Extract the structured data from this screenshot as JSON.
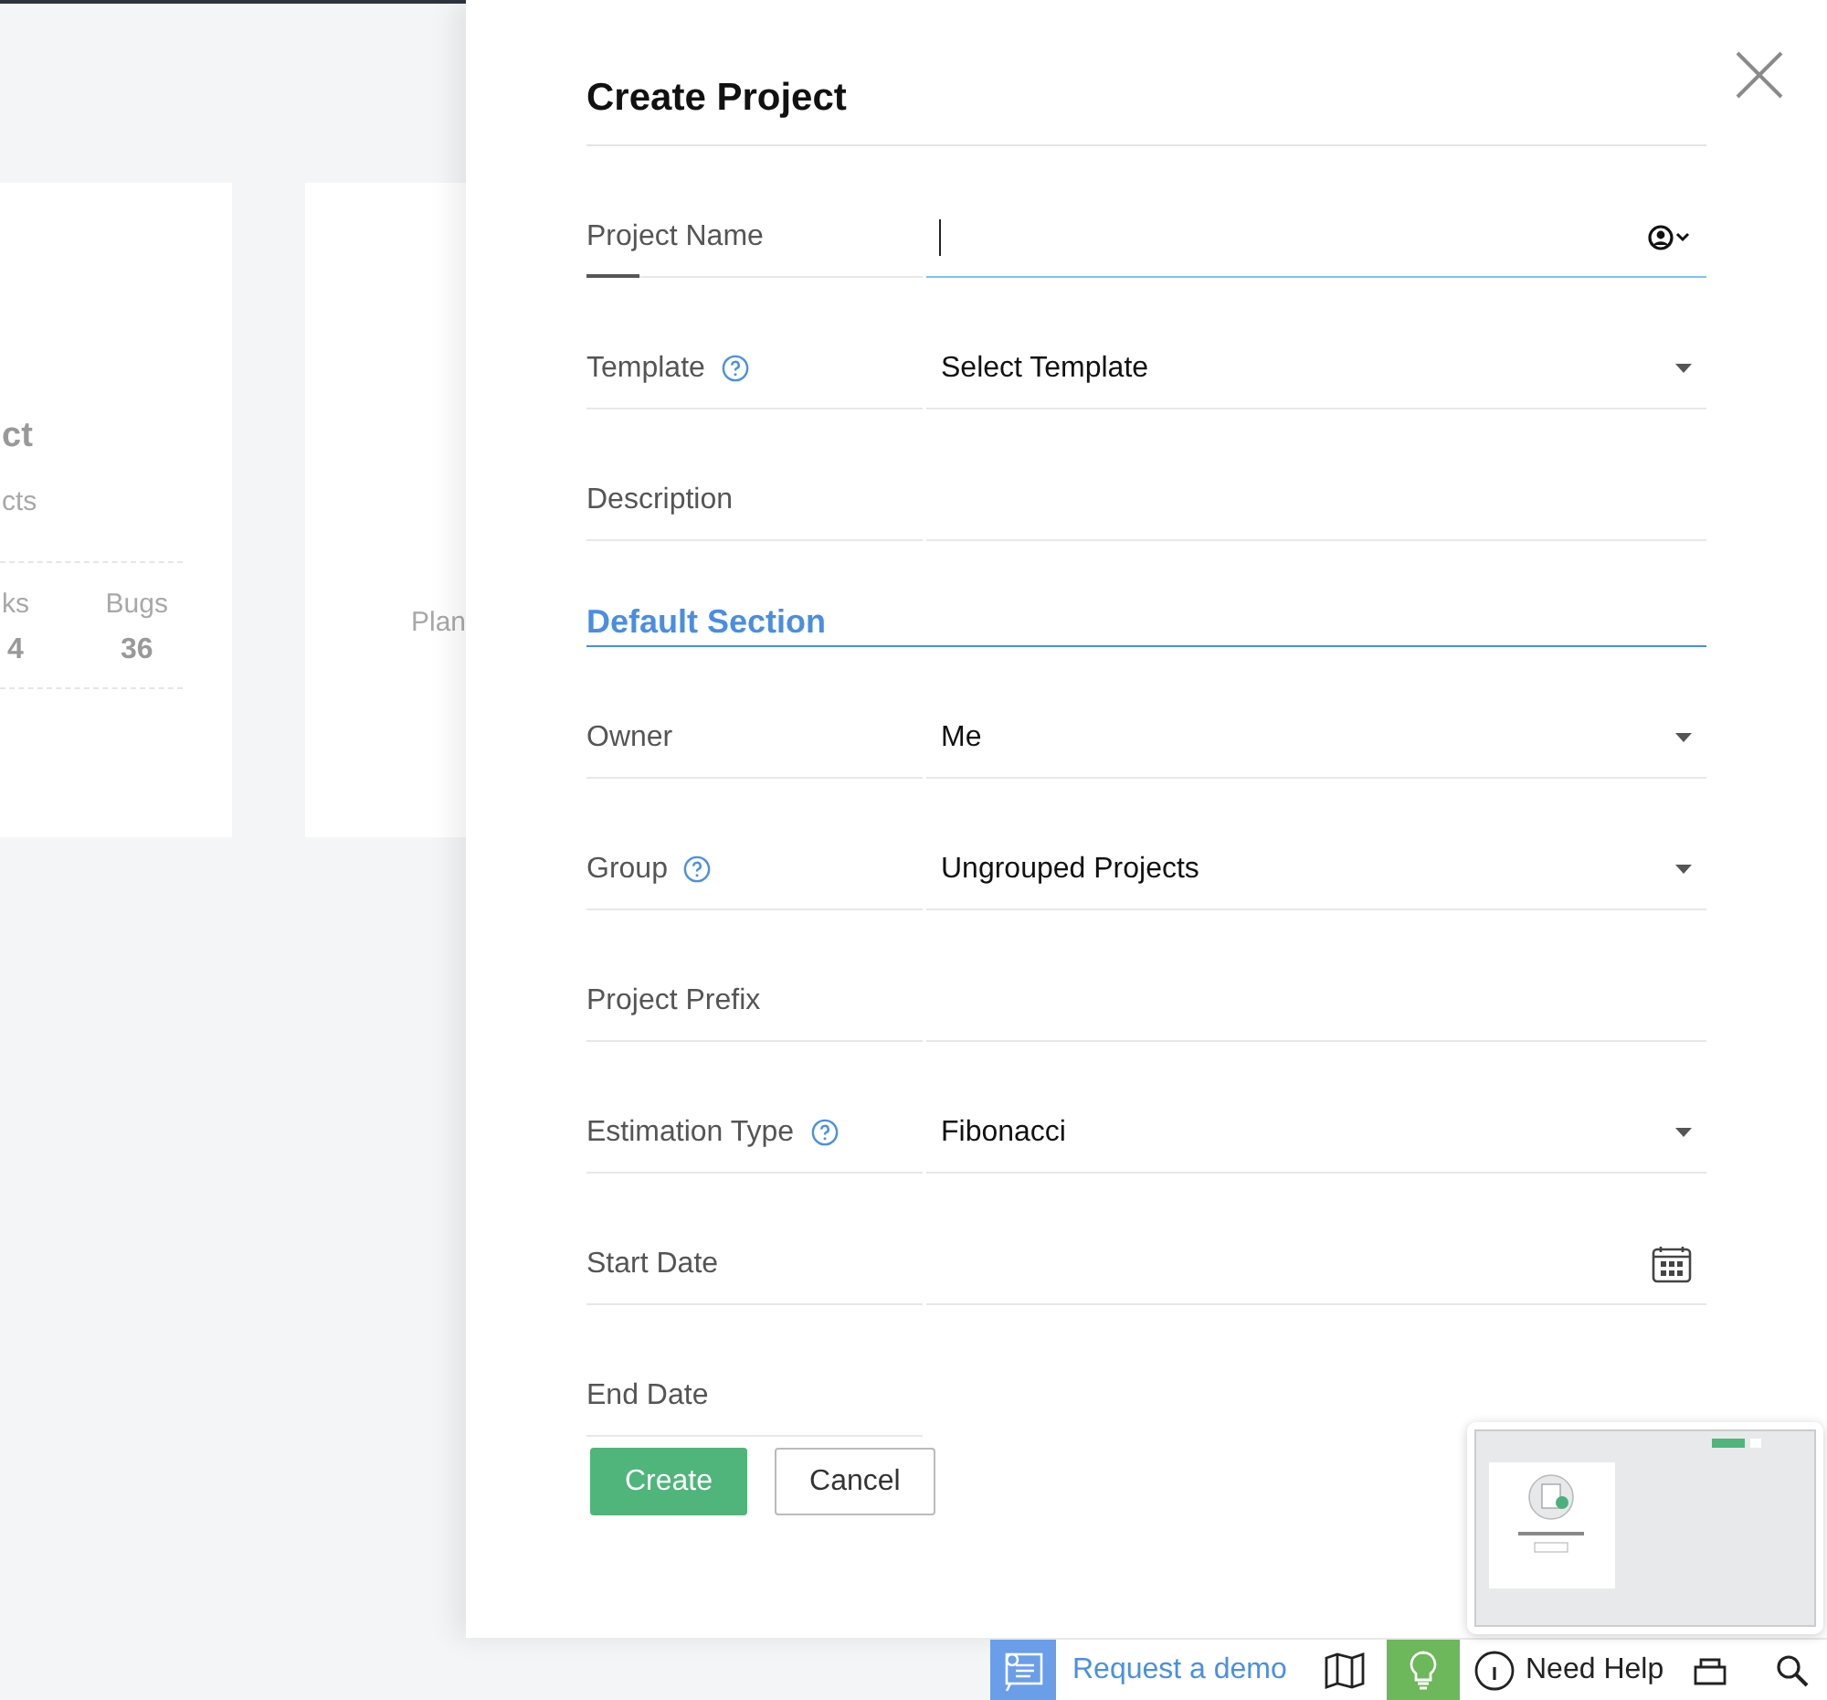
{
  "background": {
    "cards": [
      {
        "kind": "stats",
        "title": "ct",
        "subtitle": "cts",
        "stats": [
          {
            "label": "ks",
            "value": "4"
          },
          {
            "label": "Bugs",
            "value": "36"
          }
        ]
      },
      {
        "kind": "empty",
        "text": "Plan"
      }
    ]
  },
  "panel": {
    "title": "Create Project",
    "fields": [
      {
        "kind": "text",
        "label": "Project Name",
        "help": false,
        "focused": true
      },
      {
        "kind": "select",
        "label": "Template",
        "help": true,
        "focused": false,
        "value": "Select Template"
      },
      {
        "kind": "textarea",
        "label": "Description",
        "help": false,
        "focused": false
      }
    ],
    "section": "Default Section",
    "section_fields": [
      {
        "kind": "select",
        "label": "Owner",
        "help": false,
        "focused": false,
        "value": "Me"
      },
      {
        "kind": "select",
        "label": "Group",
        "help": true,
        "focused": false,
        "value": "Ungrouped Projects"
      },
      {
        "kind": "text",
        "label": "Project Prefix",
        "help": false,
        "focused": false
      },
      {
        "kind": "select",
        "label": "Estimation Type",
        "help": true,
        "focused": false,
        "value": "Fibonacci"
      },
      {
        "kind": "date",
        "label": "Start Date",
        "help": false,
        "focused": false
      },
      {
        "kind": "plain",
        "label": "End Date",
        "help": false,
        "focused": false
      }
    ],
    "buttons": [
      {
        "label": "Create",
        "primary": true
      },
      {
        "label": "Cancel",
        "primary": false
      }
    ]
  },
  "bottom_bar": {
    "demo": "Request a demo",
    "help": "Need Help"
  }
}
